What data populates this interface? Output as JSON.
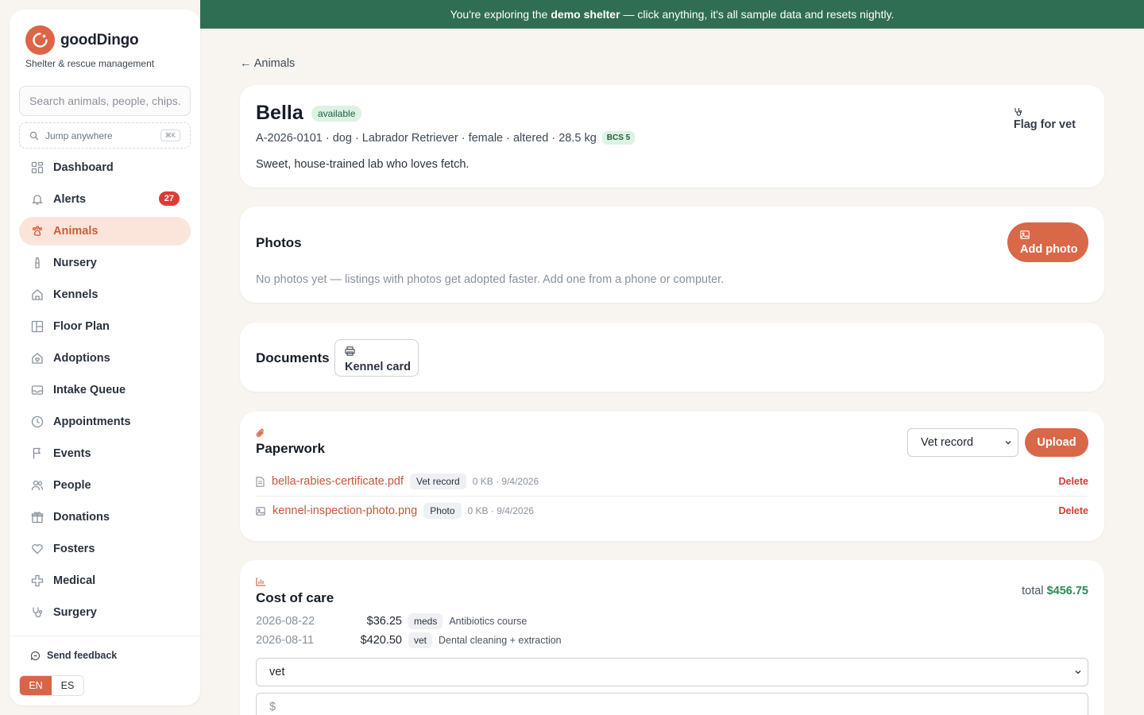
{
  "brand": {
    "name": "goodDingo",
    "tagline": "Shelter & rescue management"
  },
  "search": {
    "placeholder": "Search animals, people, chips..."
  },
  "jump": {
    "label": "Jump anywhere",
    "shortcut": "⌘K"
  },
  "nav": [
    {
      "label": "Dashboard",
      "icon": "dashboard-icon"
    },
    {
      "label": "Alerts",
      "icon": "bell-icon",
      "badge": "27"
    },
    {
      "label": "Animals",
      "icon": "paw-icon",
      "active": true
    },
    {
      "label": "Nursery",
      "icon": "bottle-icon"
    },
    {
      "label": "Kennels",
      "icon": "house-icon"
    },
    {
      "label": "Floor Plan",
      "icon": "floor-plan-icon"
    },
    {
      "label": "Adoptions",
      "icon": "heart-house-icon"
    },
    {
      "label": "Intake Queue",
      "icon": "inbox-icon"
    },
    {
      "label": "Appointments",
      "icon": "clock-icon"
    },
    {
      "label": "Events",
      "icon": "flag-icon"
    },
    {
      "label": "People",
      "icon": "people-icon"
    },
    {
      "label": "Donations",
      "icon": "gift-icon"
    },
    {
      "label": "Fosters",
      "icon": "heart-icon"
    },
    {
      "label": "Medical",
      "icon": "cross-icon"
    },
    {
      "label": "Surgery",
      "icon": "stethoscope-icon"
    }
  ],
  "feedback": {
    "label": "Send feedback"
  },
  "lang": {
    "en": "EN",
    "es": "ES",
    "active": "EN"
  },
  "banner": {
    "pre": "You're exploring the",
    "bold": "demo shelter",
    "post": "— click anything, it's all sample data and resets nightly."
  },
  "back": {
    "label": "← Animals"
  },
  "animal": {
    "name": "Bella",
    "status": "available",
    "meta": "A-2026-0101 · dog · Labrador Retriever · female · altered · 28.5 kg",
    "bcs": "BCS 5",
    "description": "Sweet, house-trained lab who loves fetch.",
    "flag_label": "Flag for vet"
  },
  "photos": {
    "title": "Photos",
    "add_label": "Add photo",
    "empty": "No photos yet — listings with photos get adopted faster. Add one from a phone or computer."
  },
  "documents": {
    "title": "Documents",
    "kennel_card_label": "Kennel card"
  },
  "paperwork": {
    "title": "Paperwork",
    "type_select": "Vet record",
    "upload_label": "Upload",
    "delete_label": "Delete",
    "files": [
      {
        "name": "bella-rabies-certificate.pdf",
        "tag": "Vet record",
        "meta": "0 KB · 9/4/2026",
        "icon": "document-icon"
      },
      {
        "name": "kennel-inspection-photo.png",
        "tag": "Photo",
        "meta": "0 KB · 9/4/2026",
        "icon": "image-icon"
      }
    ]
  },
  "cost": {
    "title": "Cost of care",
    "total_label": "total",
    "total_value": "$456.75",
    "rows": [
      {
        "date": "2026-08-22",
        "amount": "$36.25",
        "tag": "meds",
        "desc": "Antibiotics course"
      },
      {
        "date": "2026-08-11",
        "amount": "$420.50",
        "tag": "vet",
        "desc": "Dental cleaning + extraction"
      }
    ],
    "category_select": "vet",
    "amount_placeholder": "$"
  },
  "colors": {
    "accent": "#d96848",
    "banner": "#2f6e52",
    "success": "#2e8a57",
    "danger": "#d63a31"
  }
}
